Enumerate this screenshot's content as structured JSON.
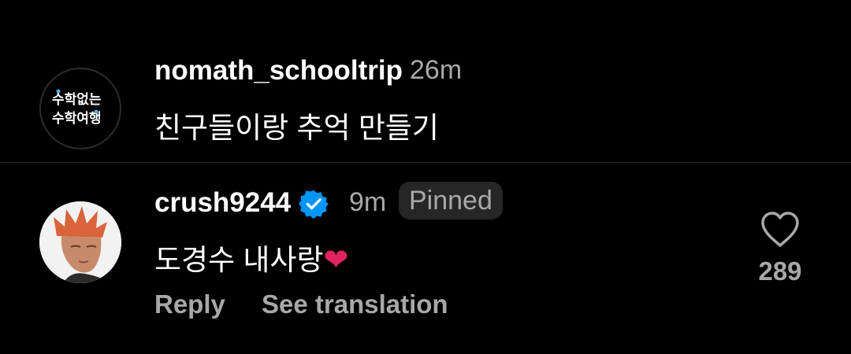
{
  "caption": {
    "username": "nomath_schooltrip",
    "time": "26m",
    "text": "친구들이랑 추억 만들기",
    "avatar_icon": "nomath-logo",
    "avatar_logo_lines": [
      "수학없는",
      "수학여행"
    ]
  },
  "comment": {
    "username": "crush9244",
    "verified_icon": "verified-badge-icon",
    "time": "9m",
    "pinned_label": "Pinned",
    "text": "도경수 내사랑",
    "emoji": "❤",
    "reply_label": "Reply",
    "translate_label": "See translation",
    "like_icon": "heart-outline-icon",
    "like_count": "289"
  },
  "colors": {
    "background": "#000000",
    "primary_text": "#ffffff",
    "secondary_text": "#a8a8a8",
    "verified_blue": "#0095f6",
    "pill_bg": "#262626",
    "heart_red": "#e0245e"
  }
}
